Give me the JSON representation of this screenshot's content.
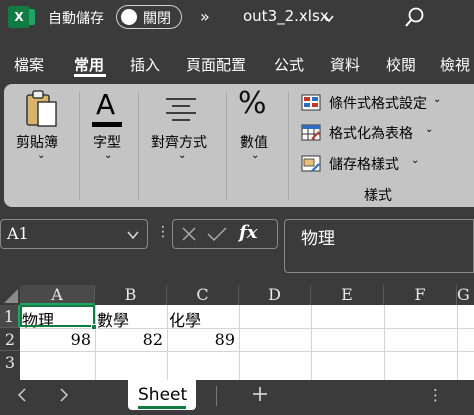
{
  "titlebar": {
    "app_icon": "excel-icon",
    "app_icon_letter": "X",
    "autosave_label": "自動儲存",
    "toggle_state": "關閉",
    "more_glyph": "»",
    "filename": "out3_2.xlsx",
    "search_icon": "search-icon"
  },
  "tabs": [
    {
      "label": "檔案"
    },
    {
      "label": "常用",
      "active": true
    },
    {
      "label": "插入"
    },
    {
      "label": "頁面配置"
    },
    {
      "label": "公式"
    },
    {
      "label": "資料"
    },
    {
      "label": "校閱"
    },
    {
      "label": "檢視"
    }
  ],
  "ribbon": {
    "clipboard_label": "剪貼簿",
    "font_label": "字型",
    "font_icon_glyph": "A",
    "alignment_label": "對齊方式",
    "number_label": "數值",
    "number_icon_glyph": "%",
    "styles": {
      "conditional_formatting": "條件式格式設定",
      "format_as_table": "格式化為表格",
      "cell_styles": "儲存格樣式",
      "group_label": "樣式"
    },
    "chevron": "⌄"
  },
  "formula_bar": {
    "name_box": "A1",
    "vdots": "⋮",
    "fx_label": "fx",
    "formula_value": "物理"
  },
  "grid": {
    "columns": [
      "A",
      "B",
      "C",
      "D",
      "E",
      "F",
      "G"
    ],
    "rows": [
      "1",
      "2",
      "3"
    ],
    "row1": [
      "物理",
      "數學",
      "化學"
    ],
    "row2": [
      "98",
      "82",
      "89"
    ],
    "selected_cell": "A1"
  },
  "sheetbar": {
    "sheet_name": "Sheet",
    "more_glyph": "⋮"
  },
  "colors": {
    "accent": "#107c41",
    "chrome": "#3b3b3b",
    "ribbon": "#c4c4c4"
  }
}
